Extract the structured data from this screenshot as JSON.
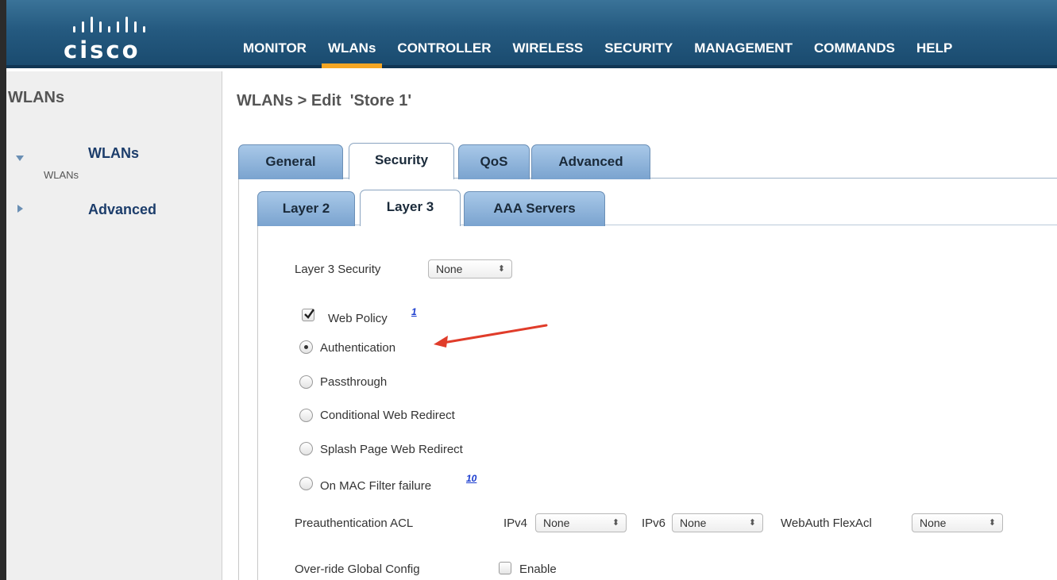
{
  "header": {
    "brand": "cisco",
    "nav": [
      {
        "label": "MONITOR",
        "active": false
      },
      {
        "label": "WLANs",
        "active": true
      },
      {
        "label": "CONTROLLER",
        "active": false
      },
      {
        "label": "WIRELESS",
        "active": false
      },
      {
        "label": "SECURITY",
        "active": false
      },
      {
        "label": "MANAGEMENT",
        "active": false
      },
      {
        "label": "COMMANDS",
        "active": false
      },
      {
        "label": "HELP",
        "active": false
      }
    ],
    "accent_color": "#f5a623"
  },
  "sidebar": {
    "title": "WLANs",
    "items": [
      {
        "label": "WLANs",
        "sub": "WLANs",
        "expanded": true
      },
      {
        "label": "Advanced",
        "expanded": false
      }
    ]
  },
  "page": {
    "title": "WLANs > Edit  'Store 1'",
    "tabs": [
      "General",
      "Security",
      "QoS",
      "Advanced"
    ],
    "active_tab": "Security",
    "subtabs": [
      "Layer 2",
      "Layer 3",
      "AAA Servers"
    ],
    "active_subtab": "Layer 3"
  },
  "form": {
    "layer3_security_label": "Layer 3 Security",
    "layer3_security_value": "None",
    "web_policy_label": "Web Policy",
    "web_policy_checked": true,
    "web_policy_note": "1",
    "radio_options": [
      {
        "label": "Authentication",
        "checked": true
      },
      {
        "label": "Passthrough",
        "checked": false
      },
      {
        "label": "Conditional Web Redirect",
        "checked": false
      },
      {
        "label": "Splash Page Web Redirect",
        "checked": false
      },
      {
        "label": "On MAC Filter failure",
        "checked": false,
        "note": "10"
      }
    ],
    "preauth_label": "Preauthentication ACL",
    "ipv4_label": "IPv4",
    "ipv4_value": "None",
    "ipv6_label": "IPv6",
    "ipv6_value": "None",
    "webauth_label": "WebAuth FlexAcl",
    "webauth_value": "None",
    "override_label": "Over-ride Global Config",
    "override_enable_label": "Enable",
    "override_enabled": false
  }
}
